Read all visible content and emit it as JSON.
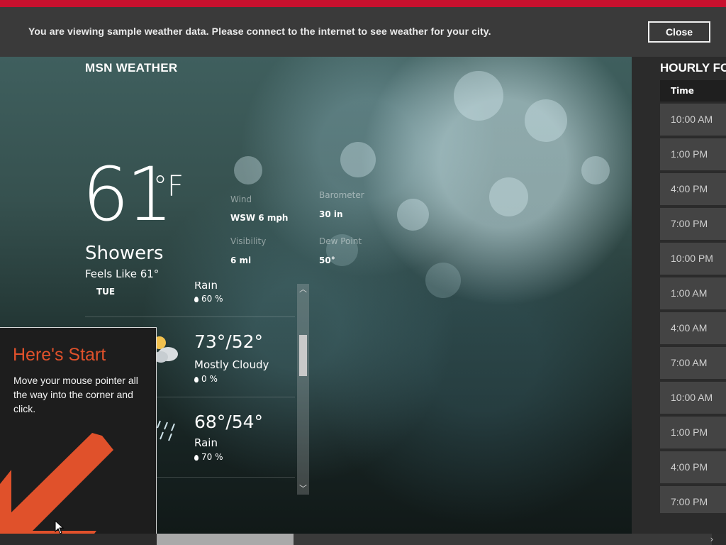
{
  "notice": {
    "text": "You are viewing sample weather data. Please connect to the internet to see weather for your city.",
    "close_label": "Close"
  },
  "app": {
    "title": "MSN WEATHER"
  },
  "current": {
    "temperature": "61",
    "unit": "°F",
    "condition": "Showers",
    "feels_like": "Feels Like 61°",
    "stats": [
      {
        "label": "Wind",
        "value": "WSW 6 mph"
      },
      {
        "label": "Barometer",
        "value": "30 in"
      },
      {
        "label": "Visibility",
        "value": "6 mi"
      },
      {
        "label": "Dew Point",
        "value": "50°"
      }
    ]
  },
  "forecast": {
    "rows": [
      {
        "day": "TUE",
        "condition": "Rain",
        "precip": "60 %"
      },
      {
        "temp": "73°/52°",
        "condition": "Mostly Cloudy",
        "precip": "0 %"
      },
      {
        "temp": "68°/54°",
        "condition": "Rain",
        "precip": "70 %"
      }
    ]
  },
  "tip": {
    "title": "Here's Start",
    "body": "Move your mouse pointer all the way into the corner and click."
  },
  "hourly": {
    "title": "HOURLY FO",
    "column_header": "Time",
    "times": [
      "10:00 AM",
      "1:00 PM",
      "4:00 PM",
      "7:00 PM",
      "10:00 PM",
      "1:00 AM",
      "4:00 AM",
      "7:00 AM",
      "10:00 AM",
      "1:00 PM",
      "4:00 PM",
      "7:00 PM"
    ]
  },
  "colors": {
    "accent_red": "#c8102e",
    "tip_orange": "#e0512b",
    "notice_bg": "#3a3a3a"
  }
}
